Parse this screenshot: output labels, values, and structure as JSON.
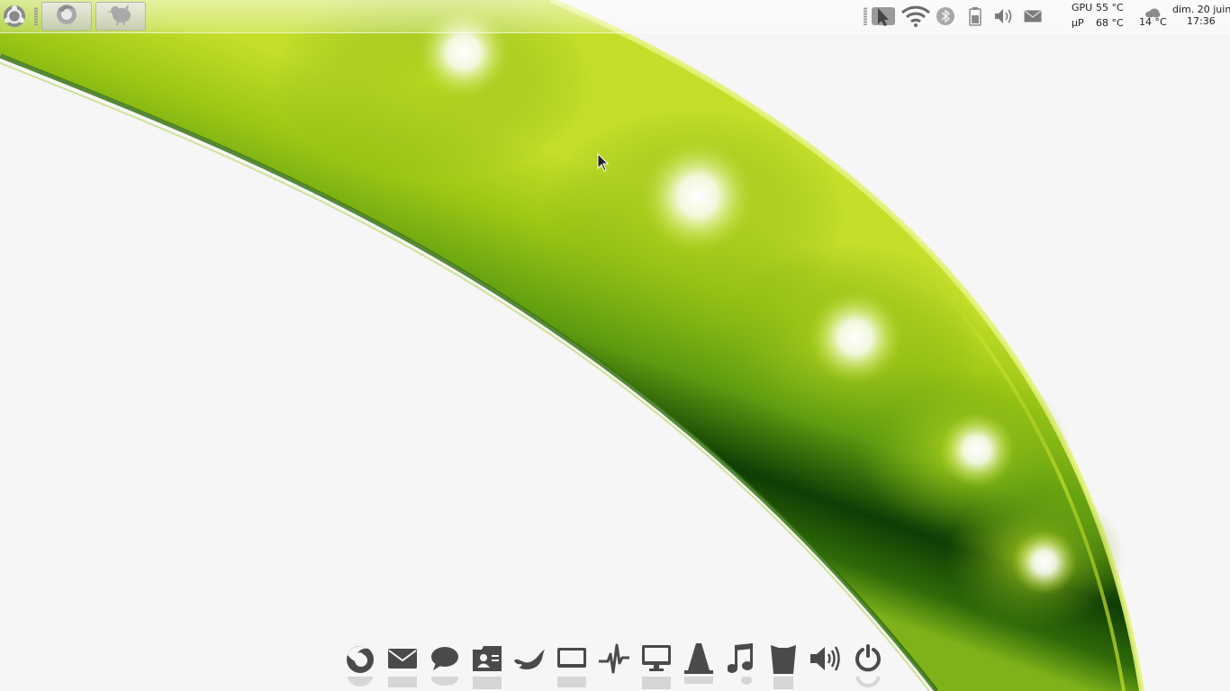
{
  "theme": {
    "background": "#f6f6f6",
    "pod_dark": "#0f3d05",
    "pod_mid": "#5c9a10",
    "pod_light": "#b9d81b",
    "icon_color": "#4a4a4a"
  },
  "top_panel": {
    "launcher": {
      "icon": "ubuntu-logo-icon"
    },
    "tasks": [
      {
        "icon": "firefox-icon"
      },
      {
        "icon": "pidgin-icon"
      }
    ],
    "tray": [
      {
        "icon": "cursor-settings-icon"
      },
      {
        "icon": "wifi-icon"
      },
      {
        "icon": "bluetooth-icon"
      },
      {
        "icon": "battery-icon"
      },
      {
        "icon": "volume-icon"
      },
      {
        "icon": "mail-icon"
      }
    ],
    "sensors": {
      "gpu_label": "GPU",
      "gpu_temp": "55 °C",
      "cpu_label": "µP",
      "cpu_temp": "68 °C"
    },
    "weather": {
      "icon": "cloud-icon",
      "temp": "14 °C"
    },
    "clock": {
      "date": "dim. 20 juin",
      "time": "17:36"
    }
  },
  "dock": {
    "items": [
      {
        "icon": "firefox-icon"
      },
      {
        "icon": "mail-icon"
      },
      {
        "icon": "chat-icon"
      },
      {
        "icon": "contacts-icon"
      },
      {
        "icon": "bird-icon"
      },
      {
        "icon": "tv-icon"
      },
      {
        "icon": "system-monitor-icon"
      },
      {
        "icon": "display-icon"
      },
      {
        "icon": "vlc-cone-icon"
      },
      {
        "icon": "music-note-icon"
      },
      {
        "icon": "trash-icon"
      },
      {
        "icon": "volume-icon"
      },
      {
        "icon": "power-icon"
      }
    ]
  }
}
